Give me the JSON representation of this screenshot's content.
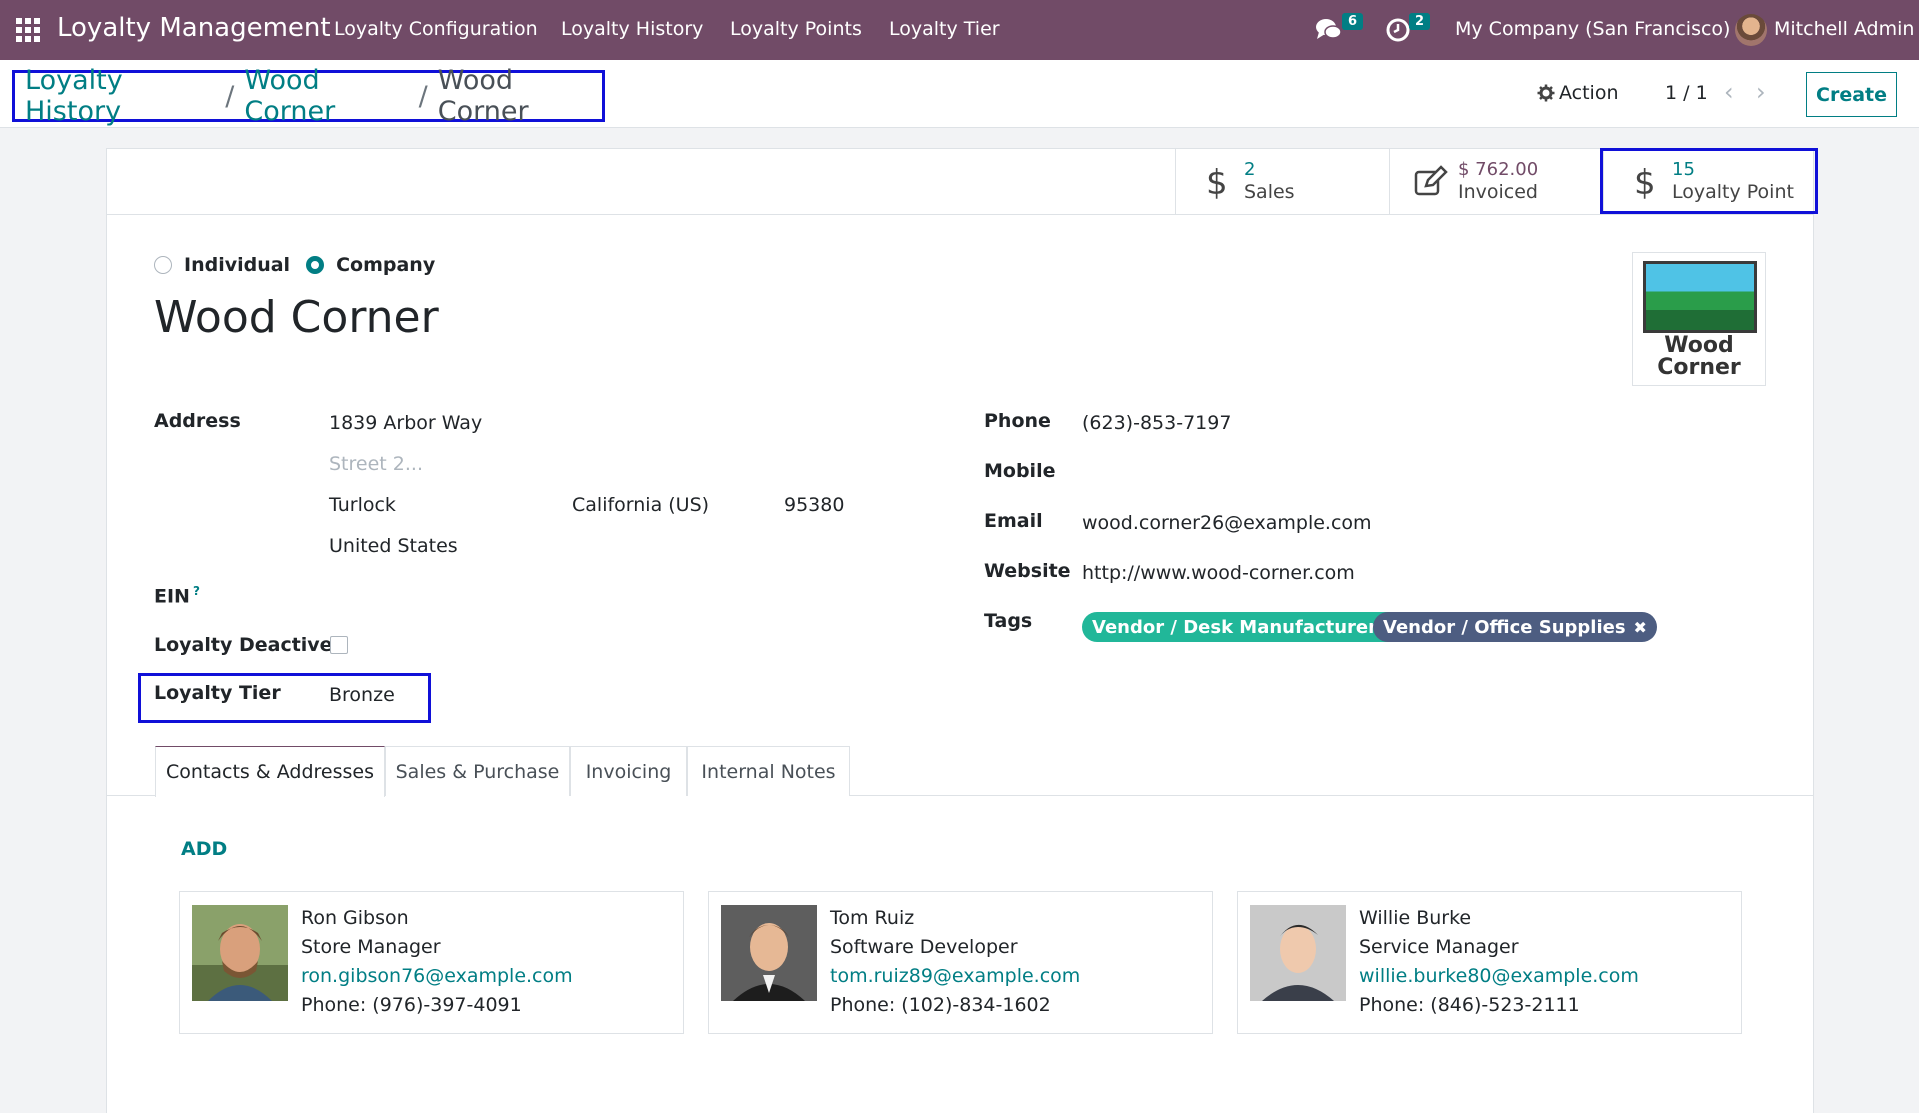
{
  "navbar": {
    "brand": "Loyalty Management",
    "menu": [
      "Loyalty Configuration",
      "Loyalty History",
      "Loyalty Points",
      "Loyalty Tier"
    ],
    "messages_count": "6",
    "activities_count": "2",
    "company": "My Company (San Francisco)",
    "user": "Mitchell Admin"
  },
  "breadcrumb": {
    "items": [
      "Loyalty History",
      "Wood Corner"
    ],
    "current": "Wood Corner"
  },
  "control": {
    "action_label": "Action",
    "pager": "1 / 1",
    "create_label": "Create"
  },
  "stats": {
    "sales": {
      "value": "2",
      "label": "Sales"
    },
    "invoiced": {
      "value": "$ 762.00",
      "label": "Invoiced"
    },
    "loyalty": {
      "value": "15",
      "label": "Loyalty Point"
    }
  },
  "form": {
    "type_options": [
      "Individual",
      "Company"
    ],
    "selected_type": "Company",
    "name": "Wood Corner",
    "logo_text": [
      "Wood",
      "Corner"
    ],
    "labels": {
      "address": "Address",
      "ein": "EIN",
      "ein_help": "?",
      "loyalty_deactive": "Loyalty Deactive",
      "loyalty_tier": "Loyalty Tier",
      "phone": "Phone",
      "mobile": "Mobile",
      "email": "Email",
      "website": "Website",
      "tags": "Tags"
    },
    "address": {
      "street": "1839 Arbor Way",
      "street2_placeholder": "Street 2...",
      "city": "Turlock",
      "state": "California (US)",
      "zip": "95380",
      "country": "United States"
    },
    "loyalty_deactive": false,
    "loyalty_tier": "Bronze",
    "phone": "(623)-853-7197",
    "mobile": "",
    "email": "wood.corner26@example.com",
    "website": "http://www.wood-corner.com",
    "tags": [
      {
        "label": "Vendor / Desk Manufacturers",
        "color": "#21b799"
      },
      {
        "label": "Vendor / Office Supplies",
        "color": "#4d5d81"
      }
    ]
  },
  "tabs": [
    "Contacts & Addresses",
    "Sales & Purchase",
    "Invoicing",
    "Internal Notes"
  ],
  "active_tab": "Contacts & Addresses",
  "contacts": {
    "add_label": "ADD",
    "cards": [
      {
        "name": "Ron Gibson",
        "role": "Store Manager",
        "email": "ron.gibson76@example.com",
        "phone": "Phone: (976)-397-4091"
      },
      {
        "name": "Tom Ruiz",
        "role": "Software Developer",
        "email": "tom.ruiz89@example.com",
        "phone": "Phone: (102)-834-1602"
      },
      {
        "name": "Willie Burke",
        "role": "Service Manager",
        "email": "willie.burke80@example.com",
        "phone": "Phone: (846)-523-2111"
      }
    ]
  },
  "colors": {
    "navbar": "#714b67",
    "accent": "#017e84",
    "highlight_box": "#1010d8"
  }
}
